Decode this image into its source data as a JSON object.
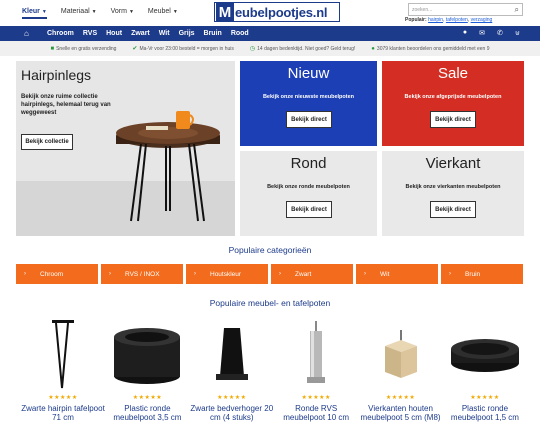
{
  "topnav": [
    {
      "label": "Kleur",
      "active": true
    },
    {
      "label": "Materiaal",
      "active": false
    },
    {
      "label": "Vorm",
      "active": false
    },
    {
      "label": "Meubel",
      "active": false
    }
  ],
  "logo": {
    "initial": "M",
    "rest": "eubelpootjes.nl"
  },
  "search": {
    "placeholder": "zoeken..."
  },
  "popular": {
    "label": "Populair:",
    "links": [
      "hairpin",
      "tafelpoten",
      "verzaging"
    ]
  },
  "bluenav": {
    "items": [
      "Chroom",
      "RVS",
      "Hout",
      "Zwart",
      "Wit",
      "Grijs",
      "Bruin",
      "Rood"
    ]
  },
  "usps": [
    "Snelle en gratis verzending",
    "Ma-Vr voor 23:00 besteld = morgen in huis",
    "14 dagen bedenktijd. Niet goed? Geld terug!",
    "3079 klanten beoordelen ons gemiddeld met een 9"
  ],
  "hero": {
    "title": "Hairpinlegs",
    "description": "Bekijk onze ruime collectie hairpinlegs, helemaal terug van weggeweest",
    "button": "Bekijk collectie"
  },
  "tiles": [
    {
      "title": "Nieuw",
      "subtitle": "Bekijk onze nieuwste meubelpoten",
      "button": "Bekijk direct",
      "color": "#1d3fb5"
    },
    {
      "title": "Sale",
      "subtitle": "Bekijk onze afgeprijsde meubelpoten",
      "button": "Bekijk direct",
      "color": "#d42e24"
    },
    {
      "title": "Rond",
      "subtitle": "Bekijk onze ronde meubelpoten",
      "button": "Bekijk direct",
      "color": "#e9e9e9"
    },
    {
      "title": "Vierkant",
      "subtitle": "Bekijk onze vierkanten meubelpoten",
      "button": "Bekijk direct",
      "color": "#e9e9e9"
    }
  ],
  "categories_title": "Populaire categorieën",
  "categories": [
    "Chroom",
    "RVS / INOX",
    "Houtskleur",
    "Zwart",
    "Wit",
    "Bruin"
  ],
  "products_title": "Populaire meubel- en tafelpoten",
  "products": [
    {
      "name": "Zwarte hairpin tafelpoot 71 cm",
      "stars": "★★★★★",
      "image": "hairpin-leg"
    },
    {
      "name": "Plastic ronde meubelpoot 3,5 cm",
      "stars": "★★★★★",
      "image": "round-black-foot"
    },
    {
      "name": "Zwarte bedverhoger 20 cm (4 stuks)",
      "stars": "★★★★★",
      "image": "bed-riser"
    },
    {
      "name": "Ronde RVS meubelpoot 10 cm",
      "stars": "★★★★★",
      "image": "steel-leg"
    },
    {
      "name": "Vierkanten houten meubelpoot 5 cm (M8)",
      "stars": "★★★★★",
      "image": "wooden-block"
    },
    {
      "name": "Plastic ronde meubelpoot 1,5 cm",
      "stars": "★★★★★",
      "image": "flat-round-foot"
    }
  ],
  "colors": {
    "brand_blue": "#1d3b8b",
    "accent_orange": "#f36b1c",
    "star": "#f2a900"
  }
}
